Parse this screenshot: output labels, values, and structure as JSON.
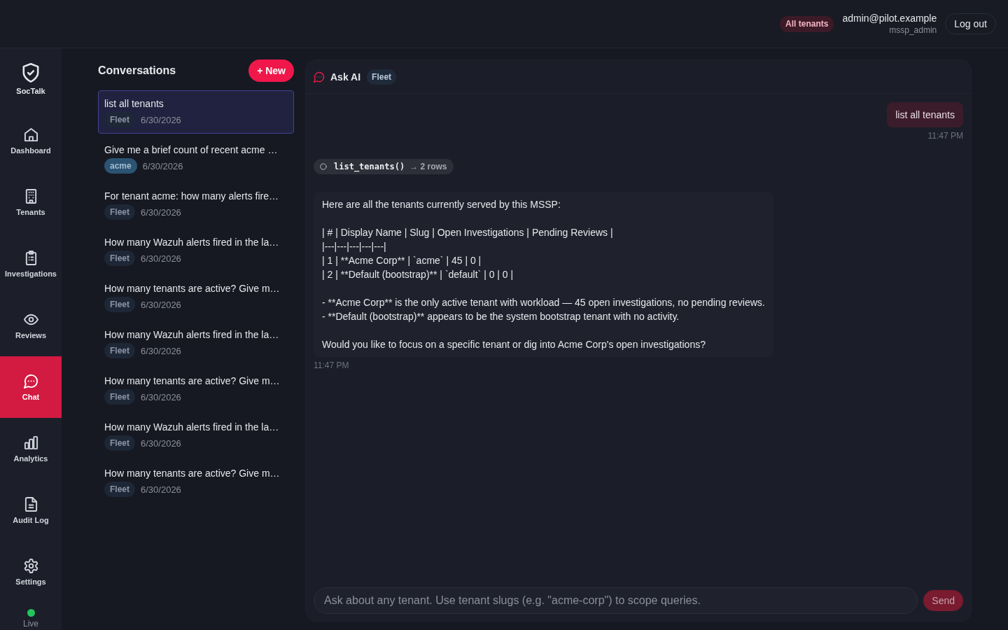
{
  "top_bar": {
    "scope_badge": "All tenants",
    "user": {
      "email": "admin@pilot.example",
      "role": "mssp_admin"
    },
    "logout_button": "Log out"
  },
  "sidebar": {
    "brand": "SocTalk",
    "items": [
      {
        "label": "Dashboard",
        "selected": false
      },
      {
        "label": "Tenants",
        "selected": false
      },
      {
        "label": "Investigations",
        "selected": false
      },
      {
        "label": "Reviews",
        "selected": false
      },
      {
        "label": "Chat",
        "selected": true
      },
      {
        "label": "Analytics",
        "selected": false
      },
      {
        "label": "Audit Log",
        "selected": false
      },
      {
        "label": "Settings",
        "selected": false
      }
    ],
    "status": {
      "label": "Live",
      "connected": true
    }
  },
  "conversations": {
    "title": "Conversations",
    "new_button": "+ New",
    "items": [
      {
        "title": "list all tenants",
        "tag": {
          "label": "Fleet",
          "kind": "fleet"
        },
        "date": "6/30/2026",
        "selected": true
      },
      {
        "title": "Give me a brief count of recent acme …",
        "tag": {
          "label": "acme",
          "kind": "tenant"
        },
        "date": "6/30/2026",
        "selected": false
      },
      {
        "title": "For tenant acme: how many alerts fire…",
        "tag": {
          "label": "Fleet",
          "kind": "fleet"
        },
        "date": "6/30/2026",
        "selected": false
      },
      {
        "title": "How many Wazuh alerts fired in the la…",
        "tag": {
          "label": "Fleet",
          "kind": "fleet"
        },
        "date": "6/30/2026",
        "selected": false
      },
      {
        "title": "How many tenants are active? Give m…",
        "tag": {
          "label": "Fleet",
          "kind": "fleet"
        },
        "date": "6/30/2026",
        "selected": false
      },
      {
        "title": "How many Wazuh alerts fired in the la…",
        "tag": {
          "label": "Fleet",
          "kind": "fleet"
        },
        "date": "6/30/2026",
        "selected": false
      },
      {
        "title": "How many tenants are active? Give m…",
        "tag": {
          "label": "Fleet",
          "kind": "fleet"
        },
        "date": "6/30/2026",
        "selected": false
      },
      {
        "title": "How many Wazuh alerts fired in the la…",
        "tag": {
          "label": "Fleet",
          "kind": "fleet"
        },
        "date": "6/30/2026",
        "selected": false
      },
      {
        "title": "How many tenants are active? Give m…",
        "tag": {
          "label": "Fleet",
          "kind": "fleet"
        },
        "date": "6/30/2026",
        "selected": false
      }
    ]
  },
  "chat": {
    "title": "Ask AI",
    "scope_badge": "Fleet",
    "messages": [
      {
        "kind": "user",
        "text": "list all tenants",
        "time": "11:47 PM"
      },
      {
        "kind": "tool_call",
        "name": "list_tenants()",
        "result": "→ 2 rows"
      },
      {
        "kind": "assistant",
        "text": "Here are all the tenants currently served by this MSSP:\n\n| # | Display Name | Slug | Open Investigations | Pending Reviews |\n|---|---|---|---|---|\n| 1 | **Acme Corp** | `acme` | 45 | 0 |\n| 2 | **Default (bootstrap)** | `default` | 0 | 0 |\n\n- **Acme Corp** is the only active tenant with workload — 45 open investigations, no pending reviews.\n- **Default (bootstrap)** appears to be the system bootstrap tenant with no activity.\n\nWould you like to focus on a specific tenant or dig into Acme Corp's open investigations?",
        "time": "11:47 PM"
      }
    ],
    "composer": {
      "placeholder": "Ask about any tenant. Use tenant slugs (e.g. \"acme-corp\") to scope queries.",
      "send": {
        "label": "Send",
        "disabled": true
      }
    }
  }
}
